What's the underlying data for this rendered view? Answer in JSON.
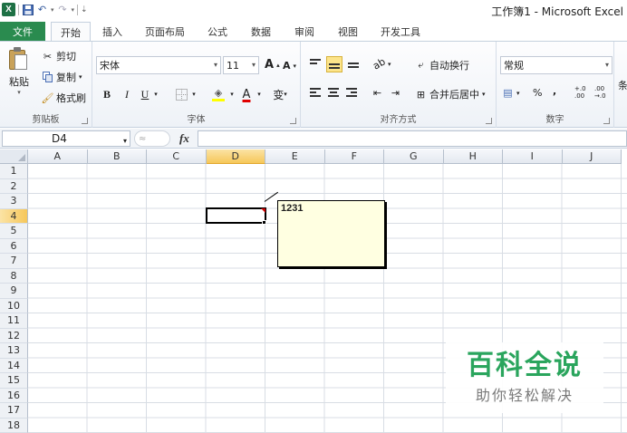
{
  "titlebar": {
    "app_logo": "X",
    "title": "工作簿1 - Microsoft Excel"
  },
  "tabs": [
    {
      "label": "文件"
    },
    {
      "label": "开始"
    },
    {
      "label": "插入"
    },
    {
      "label": "页面布局"
    },
    {
      "label": "公式"
    },
    {
      "label": "数据"
    },
    {
      "label": "审阅"
    },
    {
      "label": "视图"
    },
    {
      "label": "开发工具"
    }
  ],
  "ribbon": {
    "clipboard": {
      "paste": "粘贴",
      "cut": "剪切",
      "copy": "复制",
      "format_painter": "格式刷",
      "group_label": "剪贴板"
    },
    "font": {
      "font_name": "宋体",
      "font_size": "11",
      "grow": "A",
      "shrink": "A",
      "bold": "B",
      "italic": "I",
      "underline": "U",
      "font_color": "A",
      "phonetic": "变",
      "group_label": "字体"
    },
    "alignment": {
      "wrap_text": "自动换行",
      "merge_center": "合并后居中",
      "group_label": "对齐方式"
    },
    "number": {
      "format": "常规",
      "percent": "%",
      "comma": ",",
      "increase_decimal": "+.0 .00",
      "decrease_decimal": ".00 →.0",
      "group_label": "数字"
    },
    "overflow_label": "条"
  },
  "formula_bar": {
    "name_box": "D4",
    "fx": "fx",
    "value": ""
  },
  "grid": {
    "columns": [
      "A",
      "B",
      "C",
      "D",
      "E",
      "F",
      "G",
      "H",
      "I",
      "J"
    ],
    "rows": [
      "1",
      "2",
      "3",
      "4",
      "5",
      "6",
      "7",
      "8",
      "9",
      "10",
      "11",
      "12",
      "13",
      "14",
      "15",
      "16",
      "17",
      "18"
    ],
    "selected_column": "D",
    "selected_row": "4"
  },
  "comment": {
    "text": "1231"
  },
  "watermark": {
    "title": "百科全说",
    "subtitle": "助你轻松解决"
  },
  "colors": {
    "file_tab": "#2a8b4f",
    "selection_header": "#f6c75a",
    "comment_bg": "#ffffe1",
    "watermark_green": "#2aa55d"
  }
}
